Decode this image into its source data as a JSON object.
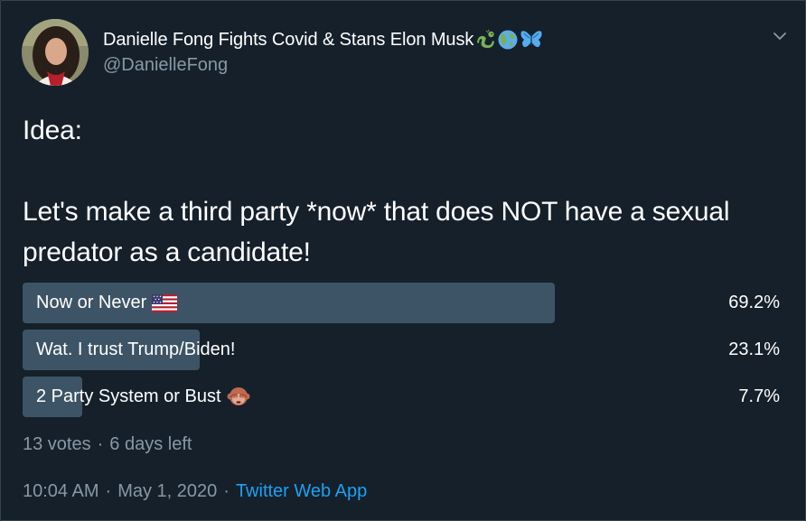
{
  "author": {
    "display_name": "Danielle Fong Fights Covid & Stans Elon Musk",
    "name_emojis": [
      "dragon-icon",
      "globe-icon",
      "butterfly-icon"
    ],
    "handle": "@DanielleFong"
  },
  "tweet": {
    "line1": "Idea:",
    "line2": "Let's make a third party *now* that does NOT have a sexual predator as a candidate!"
  },
  "poll": {
    "choices": [
      {
        "label": "Now or Never",
        "emoji": "us-flag-icon",
        "percent": "69.2%",
        "fill": 0.7
      },
      {
        "label": "Wat. I trust Trump/Biden!",
        "emoji": "",
        "percent": "23.1%",
        "fill": 0.233
      },
      {
        "label": "2 Party System or Bust",
        "emoji": "see-no-evil-monkey-icon",
        "percent": "7.7%",
        "fill": 0.078
      }
    ],
    "votes": "13 votes",
    "time_left": "6 days left"
  },
  "meta": {
    "time": "10:04 AM",
    "date": "May 1, 2020",
    "source": "Twitter Web App"
  },
  "colors": {
    "background": "#15202b",
    "secondary_text": "#8899a6",
    "accent": "#1da1f2",
    "poll_bar": "#3d5466"
  }
}
